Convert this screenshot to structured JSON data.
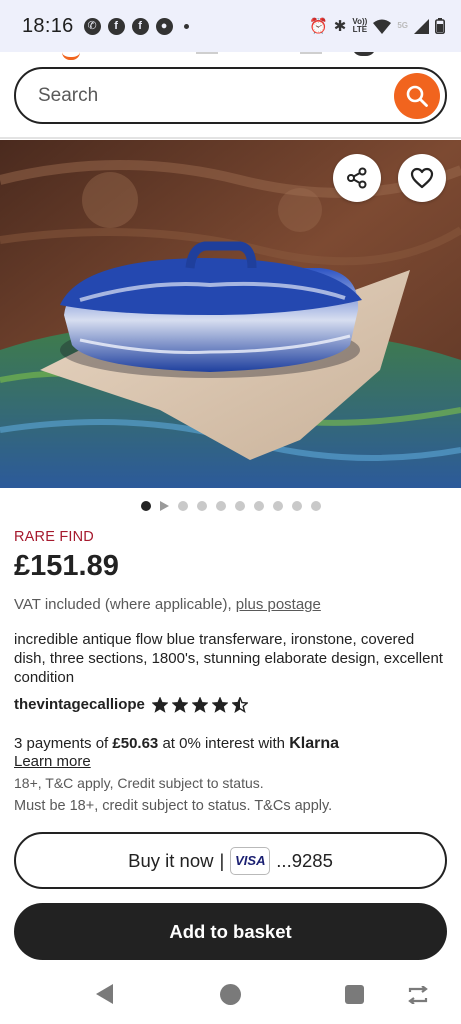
{
  "status_bar": {
    "time": "18:16",
    "network_label": "5G",
    "volte_label_top": "Vo))",
    "volte_label_bottom": "LTE"
  },
  "search": {
    "placeholder": "Search"
  },
  "listing": {
    "badge": "RARE FIND",
    "price": "£151.89",
    "vat_text": "VAT included (where applicable), ",
    "postage_link": "plus postage",
    "title": "incredible antique flow blue transferware, ironstone, covered dish, three sections, 1800's, stunning elaborate design, excellent condition",
    "shop_name": "thevintagecalliope",
    "rating": 4.5
  },
  "klarna": {
    "prefix": "3 payments of ",
    "amount": "£50.63",
    "middle": " at 0% interest with ",
    "brand": "Klarna",
    "learn_more": "Learn more",
    "disclaimer_1": "18+, T&C apply, Credit subject to status.",
    "disclaimer_2": "Must be 18+, credit subject to status. T&Cs apply."
  },
  "actions": {
    "buy_now_label": "Buy it now",
    "buy_now_separator": "|",
    "card_brand": "VISA",
    "card_last4": "...9285",
    "add_to_basket_label": "Add to basket"
  },
  "carousel": {
    "image_count": 10,
    "active_index": 0
  },
  "colors": {
    "accent": "#f1641e",
    "badge": "#a61a2e",
    "primary_button": "#222222"
  }
}
